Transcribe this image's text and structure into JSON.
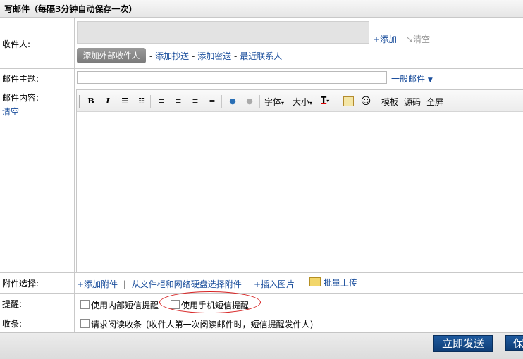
{
  "title": "写邮件（每隔3分钟自动保存一次）",
  "recipient": {
    "label": "收件人:",
    "add": "+添加",
    "clear": "清空",
    "add_external": "添加外部收件人",
    "links": [
      "添加抄送",
      "添加密送",
      "最近联系人"
    ],
    "sep": "-"
  },
  "subject": {
    "label": "邮件主题:",
    "value": "",
    "category": "一般邮件"
  },
  "content": {
    "label": "邮件内容:",
    "clear": "清空",
    "toolbar": {
      "font": "字体",
      "size": "大小",
      "template": "模板",
      "source": "源码",
      "fullscreen": "全屏"
    }
  },
  "attachment": {
    "label": "附件选择:",
    "add": "+添加附件",
    "sep": "|",
    "select_cabinet": "从文件柜和网络硬盘选择附件",
    "insert_image": "+插入图片",
    "batch_upload": "批量上传"
  },
  "reminder": {
    "label": "提醒:",
    "internal_sms": "使用内部短信提醒",
    "mobile_sms": "使用手机短信提醒"
  },
  "receipt": {
    "label": "收条:",
    "request": "请求阅读收条",
    "note": "(收件人第一次阅读邮件时，短信提醒发件人)"
  },
  "footer": {
    "send": "立即发送",
    "save": "保"
  }
}
